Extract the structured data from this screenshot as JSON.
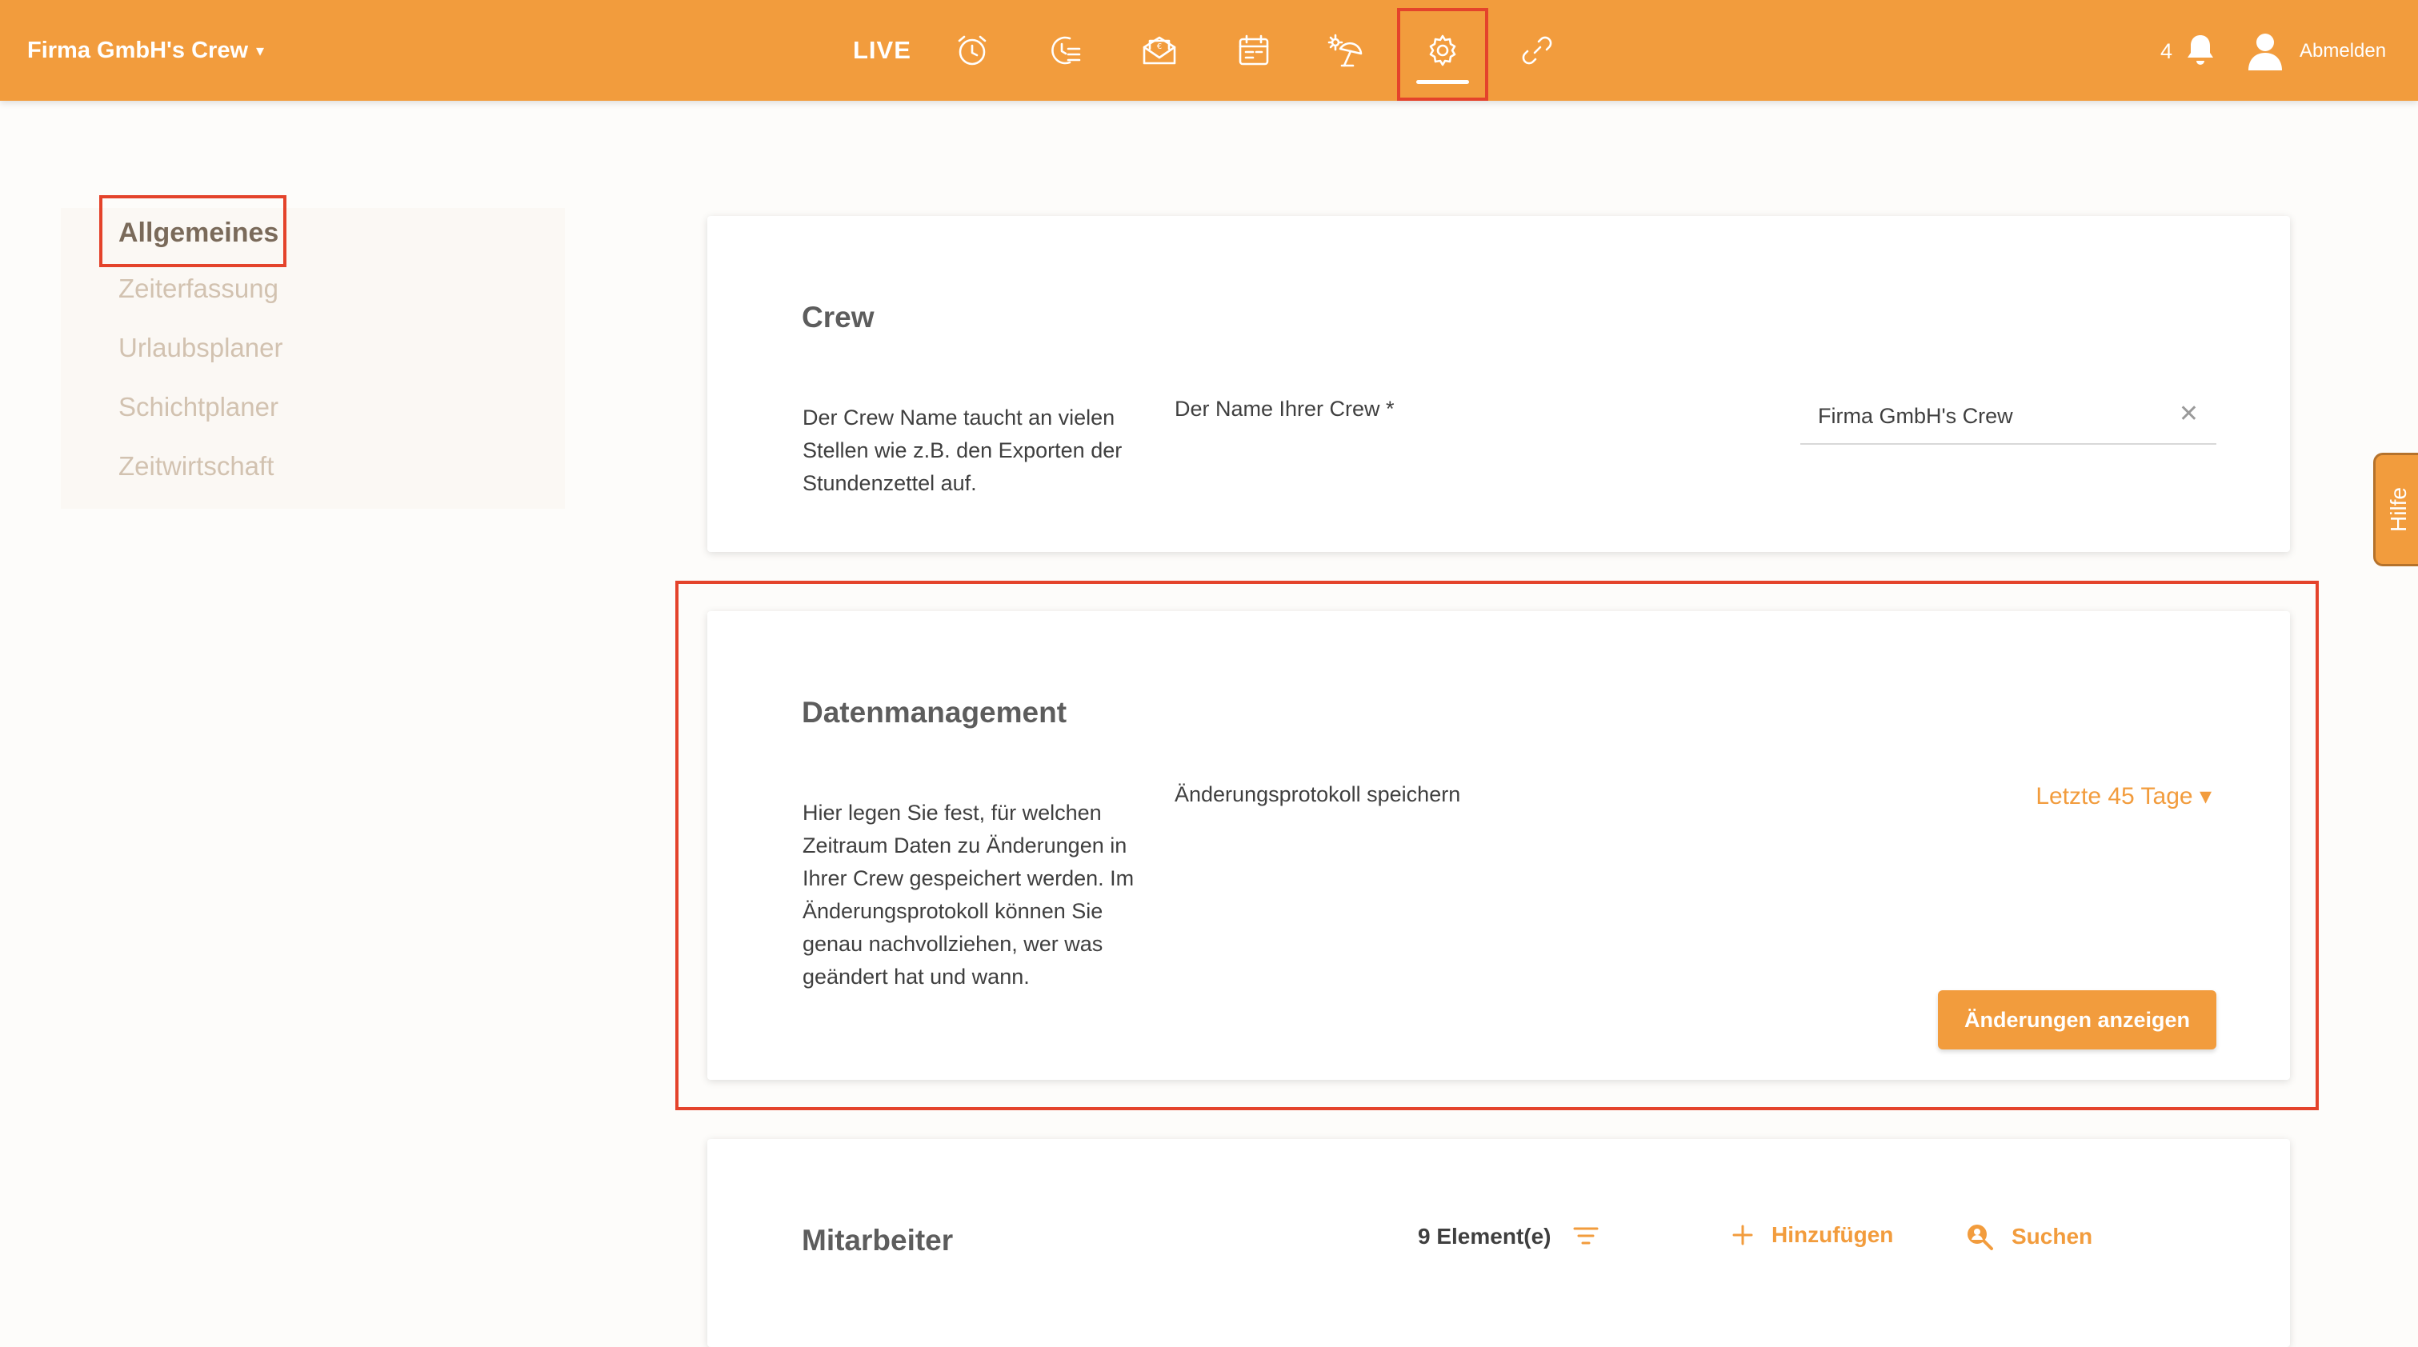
{
  "header": {
    "crew_name": "Firma GmbH's Crew",
    "crew_caret": "▾",
    "live_label": "LIVE",
    "nav_icons": [
      "alarm-clock-icon",
      "timesheet-icon",
      "payroll-envelope-icon",
      "calendar-icon",
      "vacation-umbrella-icon",
      "gear-icon",
      "link-icon"
    ],
    "active_nav": "gear-icon",
    "notification_count": "4",
    "logout_label": "Abmelden"
  },
  "sidebar": {
    "items": [
      {
        "label": "Allgemeines",
        "active": true
      },
      {
        "label": "Zeiterfassung",
        "active": false
      },
      {
        "label": "Urlaubsplaner",
        "active": false
      },
      {
        "label": "Schichtplaner",
        "active": false
      },
      {
        "label": "Zeitwirtschaft",
        "active": false
      }
    ]
  },
  "crew_card": {
    "title": "Crew",
    "description": "Der Crew Name taucht an vielen Stellen wie z.B. den Exporten der Stundenzettel auf.",
    "field_label": "Der Name Ihrer Crew *",
    "field_value": "Firma GmbH's Crew",
    "clear_symbol": "✕"
  },
  "data_card": {
    "title": "Datenmanagement",
    "description": "Hier legen Sie fest, für welchen Zeitraum Daten zu Änderungen in Ihrer Crew gespeichert werden. Im Änderungsprotokoll können Sie genau nachvollziehen, wer was geändert hat und wann.",
    "field_label": "Änderungsprotokoll speichern",
    "period_value": "Letzte 45 Tage",
    "period_caret": "▾",
    "button_label": "Änderungen anzeigen"
  },
  "employees_card": {
    "title": "Mitarbeiter",
    "count_label": "9 Element(e)",
    "add_label": "Hinzufügen",
    "search_label": "Suchen"
  },
  "help_tab": {
    "label": "Hilfe"
  },
  "colors": {
    "accent": "#f29c3d",
    "highlight": "#e4432b",
    "sidebar_inactive": "#d2c2b0",
    "sidebar_active": "#7a6a5a"
  }
}
